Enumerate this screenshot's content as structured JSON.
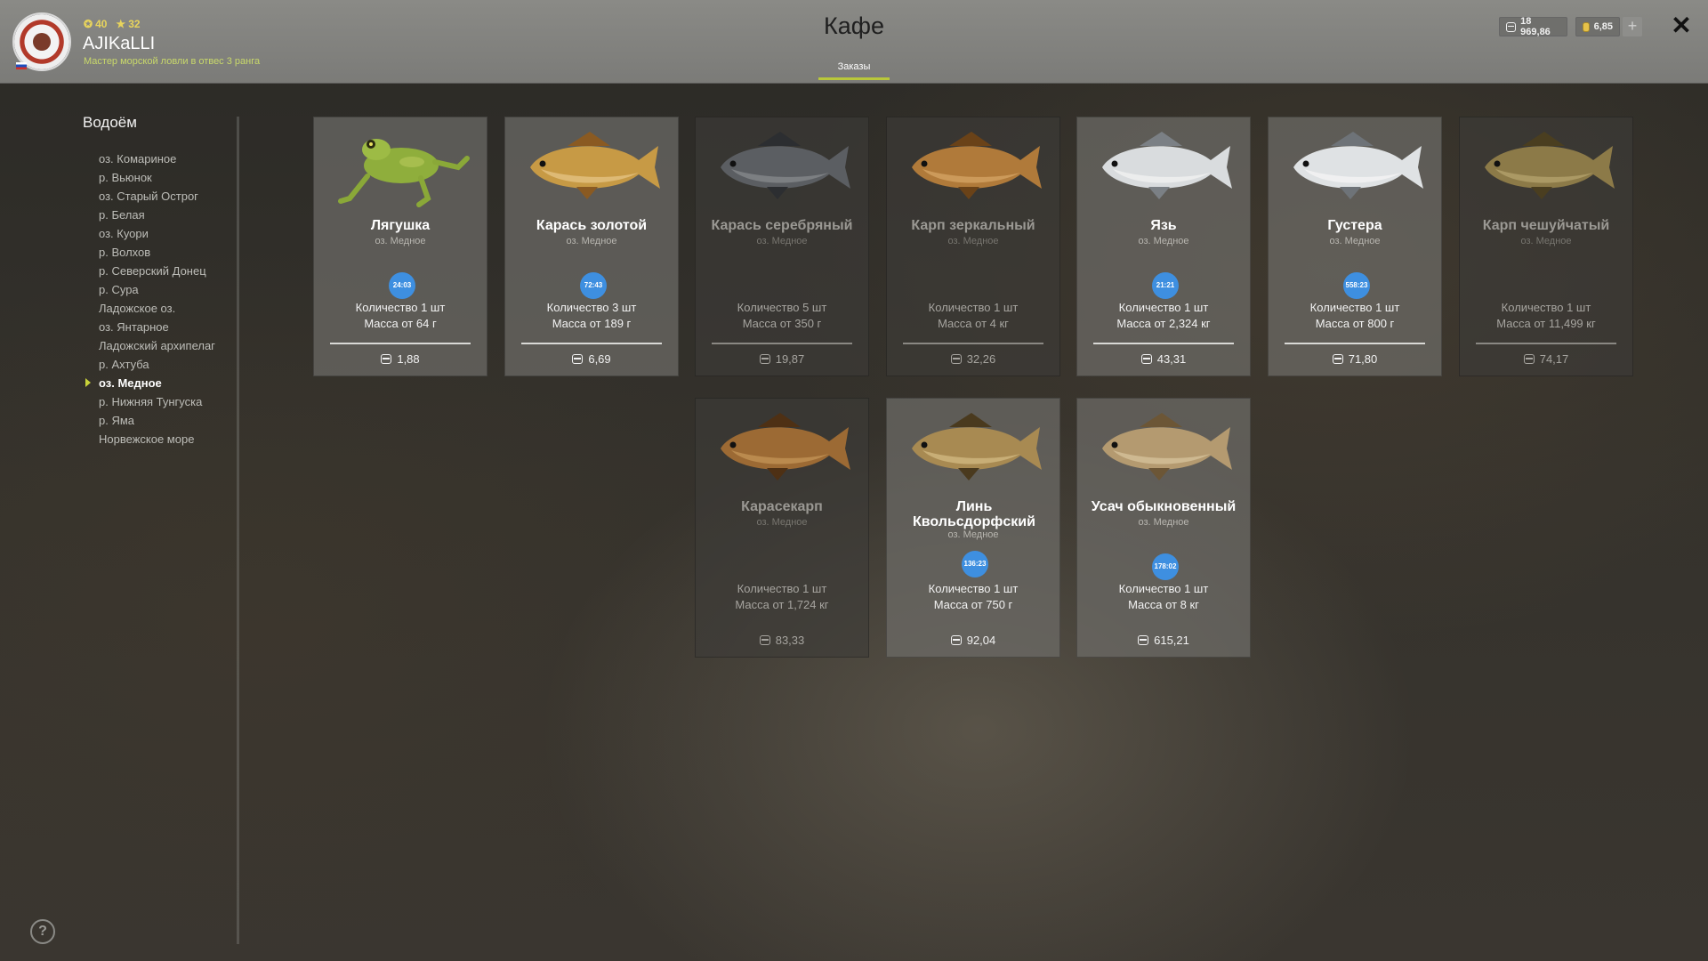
{
  "player": {
    "level": "40",
    "rank": "32",
    "name": "AJIKaLLI",
    "title": "Мастер морской ловли в отвес 3 ранга",
    "flag": "ru"
  },
  "header": {
    "title": "Кафе",
    "tab_orders": "Заказы",
    "currency_silver": "18 969,86",
    "currency_gold": "6,85",
    "plus": "+",
    "close": "✕"
  },
  "sidebar": {
    "heading": "Водоём",
    "lakes": [
      "оз. Комариное",
      "р. Вьюнок",
      "оз. Старый Острог",
      "р. Белая",
      "оз. Куори",
      "р. Волхов",
      "р. Северский Донец",
      "р. Сура",
      "Ладожское оз.",
      "оз. Янтарное",
      "Ладожский архипелаг",
      "р. Ахтуба",
      "оз. Медное",
      "р. Нижняя Тунгуска",
      "р. Яма",
      "Норвежское море"
    ],
    "active_index": 12,
    "help": "?"
  },
  "orders": [
    {
      "name": "Лягушка",
      "lake": "оз. Медное",
      "timer": "24:03",
      "qty": "Количество 1 шт",
      "mass": "Масса от 64 г",
      "price": "1,88",
      "enabled": true,
      "kind": "frog"
    },
    {
      "name": "Карась золотой",
      "lake": "оз. Медное",
      "timer": "72:43",
      "qty": "Количество 3 шт",
      "mass": "Масса от 189 г",
      "price": "6,69",
      "enabled": true,
      "kind": "gold-crucian"
    },
    {
      "name": "Карась серебряный",
      "lake": "оз. Медное",
      "timer": "",
      "qty": "Количество 5 шт",
      "mass": "Масса от 350 г",
      "price": "19,87",
      "enabled": false,
      "kind": "silver-crucian"
    },
    {
      "name": "Карп зеркальный",
      "lake": "оз. Медное",
      "timer": "",
      "qty": "Количество 1 шт",
      "mass": "Масса от 4 кг",
      "price": "32,26",
      "enabled": false,
      "kind": "mirror-carp"
    },
    {
      "name": "Язь",
      "lake": "оз. Медное",
      "timer": "21:21",
      "qty": "Количество 1 шт",
      "mass": "Масса от 2,324 кг",
      "price": "43,31",
      "enabled": true,
      "kind": "ide"
    },
    {
      "name": "Густера",
      "lake": "оз. Медное",
      "timer": "558:23",
      "qty": "Количество 1 шт",
      "mass": "Масса от 800 г",
      "price": "71,80",
      "enabled": true,
      "kind": "bream"
    },
    {
      "name": "Карп чешуйчатый",
      "lake": "оз. Медное",
      "timer": "",
      "qty": "Количество 1 шт",
      "mass": "Масса от 11,499 кг",
      "price": "74,17",
      "enabled": false,
      "kind": "scaly-carp"
    },
    {
      "name": "Карасекарп",
      "lake": "оз. Медное",
      "timer": "",
      "qty": "Количество 1 шт",
      "mass": "Масса от 1,724 кг",
      "price": "83,33",
      "enabled": false,
      "kind": "hybrid-carp"
    },
    {
      "name": "Линь Квольсдорфский",
      "lake": "оз. Медное",
      "timer": "136:23",
      "qty": "Количество 1 шт",
      "mass": "Масса от 750 г",
      "price": "92,04",
      "enabled": true,
      "kind": "tench"
    },
    {
      "name": "Усач обыкновенный",
      "lake": "оз. Медное",
      "timer": "178:02",
      "qty": "Количество 1 шт",
      "mass": "Масса от 8 кг",
      "price": "615,21",
      "enabled": true,
      "kind": "barbel"
    }
  ],
  "colors": {
    "accent": "#b9c83a",
    "timer": "#3e8fe0",
    "header_bg": "#7f7f7c"
  }
}
